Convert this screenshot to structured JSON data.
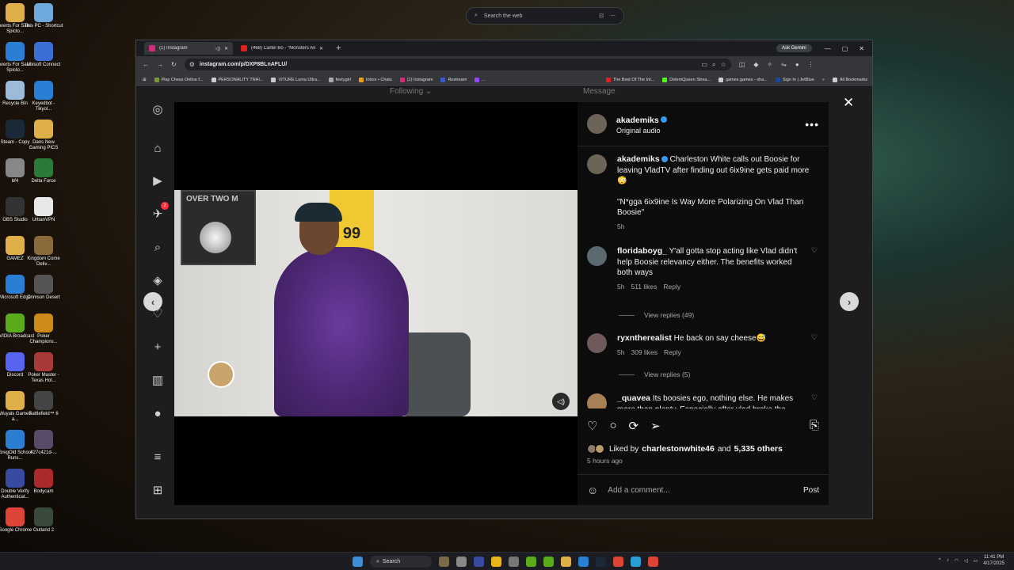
{
  "desktop": {
    "icons": [
      {
        "label": "Inverts For Sale - Spicto...",
        "color": "#e0b048"
      },
      {
        "label": "This PC - Shortcut",
        "color": "#6fa8dc"
      },
      {
        "label": "Inverts For Sale - Spicto...",
        "color": "#2a7fd4"
      },
      {
        "label": "Ubisoft Connect",
        "color": "#3b6fd4"
      },
      {
        "label": "Recycle Bin",
        "color": "#9bbbd9"
      },
      {
        "label": "Keyedbot - Tikyol...",
        "color": "#2a7fd4"
      },
      {
        "label": "Steam - Copy",
        "color": "#1b2838"
      },
      {
        "label": "Dans New Gaming PICS",
        "color": "#e0b048"
      },
      {
        "label": "bf4",
        "color": "#888"
      },
      {
        "label": "Delta Force",
        "color": "#2a7a3a"
      },
      {
        "label": "OBS Studio",
        "color": "#333"
      },
      {
        "label": "UrbanVPN",
        "color": "#e8e8e8"
      },
      {
        "label": "GAMEZ",
        "color": "#e0b048"
      },
      {
        "label": "Kingdom Come Deliv...",
        "color": "#8a6a3a"
      },
      {
        "label": "Microsoft Edge",
        "color": "#2a7fd4"
      },
      {
        "label": "Crimson Desert",
        "color": "#555"
      },
      {
        "label": "NVIDIA Broadcast",
        "color": "#5aaa1a"
      },
      {
        "label": "Poker Champions...",
        "color": "#cc8a1a"
      },
      {
        "label": "Discord",
        "color": "#5865f2"
      },
      {
        "label": "Poker Master - Texas Hol...",
        "color": "#aa3a3a"
      },
      {
        "label": "Wuyals Games a...",
        "color": "#e0b048"
      },
      {
        "label": "Battlefield™ 6",
        "color": "#444"
      },
      {
        "label": "GregOld School Runs...",
        "color": "#2a7fd4"
      },
      {
        "label": "427c421d-...",
        "color": "#5a4a6a"
      },
      {
        "label": "Double Verify Authenticat...",
        "color": "#3a4aa0"
      },
      {
        "label": "Bodycam",
        "color": "#aa2a2a"
      },
      {
        "label": "Google Chrome",
        "color": "#db4437"
      },
      {
        "label": "Outland 2",
        "color": "#3a4a3a"
      }
    ]
  },
  "top_search": {
    "placeholder": "Search the web"
  },
  "browser": {
    "tabs": [
      {
        "title": "(1) Instagram",
        "active": true,
        "favicon": "#d6297a"
      },
      {
        "title": "(468) Cartel Bo - \"Monsters Am...",
        "active": false,
        "favicon": "#e02020"
      }
    ],
    "gemini_label": "Ask Gemini",
    "url": "instagram.com/p/DXP8BLnAFLU/",
    "bookmarks": [
      "Play Chess Online f...",
      "PERSONALITY TRAI...",
      "VITURE Luma Ultra...",
      "feetygirl",
      "Inbox • Chats",
      "(1) Instagram",
      "Restream",
      "...",
      "The Best Of The Int...",
      "DelemQueen Strea...",
      "games games - sha...",
      "Sign In | JetBlue",
      "All Bookmarks"
    ]
  },
  "ig": {
    "following_label": "Following",
    "messages_label": "Message",
    "notif_count": "2",
    "post": {
      "username": "akademiks",
      "subtitle": "Original audio",
      "caption_user": "akademiks",
      "caption_text": "Charleston White calls out Boosie for leaving VladTV after finding out 6ix9ine gets paid more 😳",
      "caption_quote": "\"N*gga 6ix9ine Is Way More Polarizing On Vlad Than Boosie\"",
      "caption_time": "5h"
    },
    "comments": [
      {
        "user": "floridaboyg_",
        "text": "Y'all gotta stop acting like Vlad didn't help Boosie relevancy either. The benefits worked both ways",
        "time": "5h",
        "likes": "511 likes",
        "reply": "Reply",
        "view_replies": "View replies (49)"
      },
      {
        "user": "ryxntherealist",
        "text": "He back on say cheese😅",
        "time": "5h",
        "likes": "309 likes",
        "reply": "Reply",
        "view_replies": "View replies (5)"
      },
      {
        "user": "_quavea",
        "text": "Its boosies ego, nothing else. He makes more than plenty. Especially after vlad broke the"
      }
    ],
    "liked_prefix": "Liked by",
    "liked_user": "charlestonwhite46",
    "liked_suffix": "and",
    "liked_others": "5,335 others",
    "time_ago": "5 hours ago",
    "add_comment": "Add a comment...",
    "post_label": "Post",
    "video_labels": {
      "poster": "OVER TWO M",
      "jersey_num": "99"
    }
  },
  "taskbar": {
    "search": "Search",
    "time": "11:41 PM",
    "date": "4/17/2025"
  }
}
